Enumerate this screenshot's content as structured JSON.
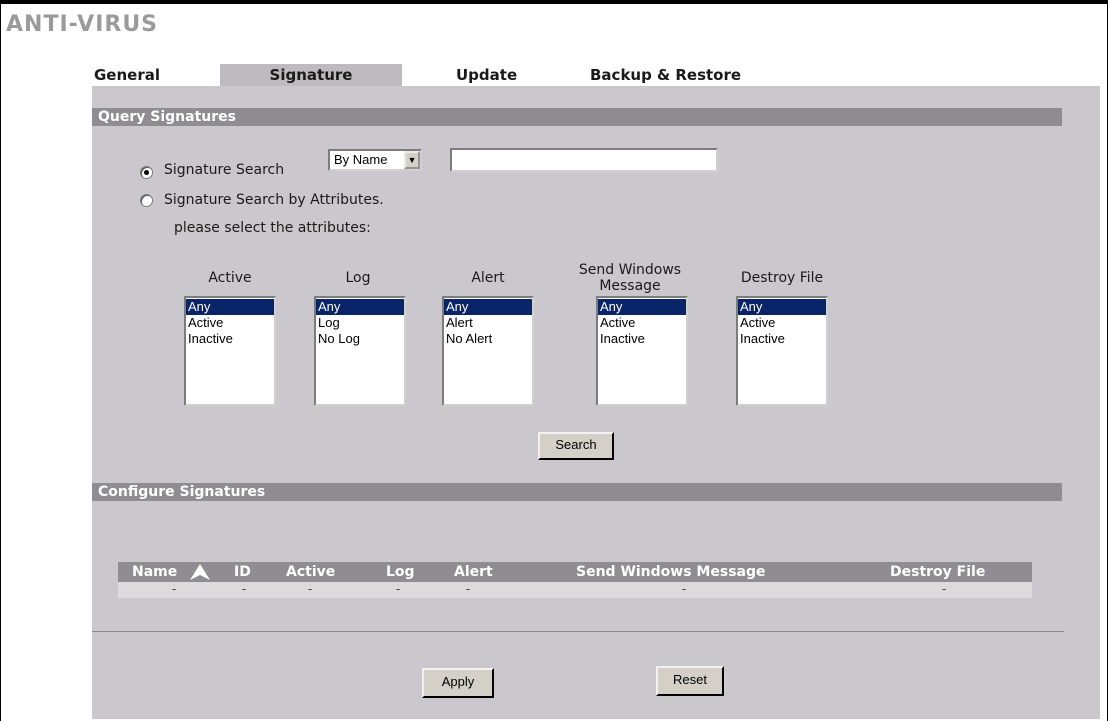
{
  "page": {
    "title": "ANTI-VIRUS"
  },
  "tabs": [
    {
      "label": "General",
      "active": false
    },
    {
      "label": "Signature",
      "active": true
    },
    {
      "label": "Update",
      "active": false
    },
    {
      "label": "Backup & Restore",
      "active": false
    }
  ],
  "query": {
    "section_title": "Query Signatures",
    "radio_search_label": "Signature Search",
    "radio_search_checked": true,
    "search_by_selected": "By Name",
    "search_text_value": "",
    "radio_attr_label": "Signature Search by Attributes.",
    "radio_attr_checked": false,
    "attr_hint": "please select the attributes:",
    "columns": [
      {
        "header": "Active",
        "options": [
          "Any",
          "Active",
          "Inactive"
        ],
        "selected": "Any"
      },
      {
        "header": "Log",
        "options": [
          "Any",
          "Log",
          "No Log"
        ],
        "selected": "Any"
      },
      {
        "header": "Alert",
        "options": [
          "Any",
          "Alert",
          "No Alert"
        ],
        "selected": "Any"
      },
      {
        "header": "Send Windows Message",
        "options": [
          "Any",
          "Active",
          "Inactive"
        ],
        "selected": "Any"
      },
      {
        "header": "Destroy File",
        "options": [
          "Any",
          "Active",
          "Inactive"
        ],
        "selected": "Any"
      }
    ],
    "search_button": "Search"
  },
  "configure": {
    "section_title": "Configure Signatures",
    "table_headers": [
      "Name",
      "ID",
      "Active",
      "Log",
      "Alert",
      "Send Windows Message",
      "Destroy File"
    ],
    "sort_icon": "sort-ascending-icon",
    "rows": [
      [
        "-",
        "-",
        "-",
        "-",
        "-",
        "-",
        "-"
      ]
    ]
  },
  "footer": {
    "apply_label": "Apply",
    "reset_label": "Reset"
  },
  "colors": {
    "panel_bg": "#cac8cc",
    "section_bar": "#8f8d92",
    "selection": "#0a246a",
    "title_gray": "#9a9a9a"
  }
}
